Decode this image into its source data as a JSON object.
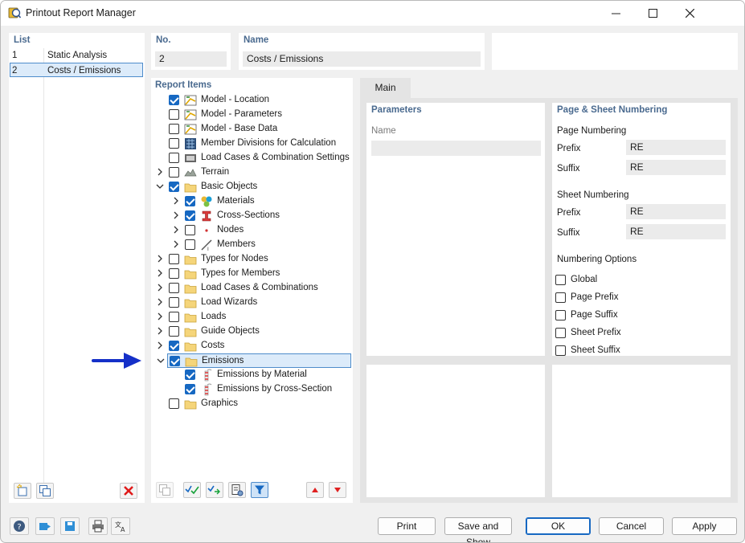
{
  "window": {
    "title": "Printout Report Manager"
  },
  "list": {
    "label": "List",
    "rows": [
      {
        "no": "1",
        "name": "Static Analysis"
      },
      {
        "no": "2",
        "name": "Costs / Emissions"
      }
    ]
  },
  "header": {
    "no_label": "No.",
    "no_value": "2",
    "name_label": "Name",
    "name_value": "Costs / Emissions"
  },
  "report_items": {
    "label": "Report Items",
    "items": [
      {
        "label": "Model - Location",
        "checked": true,
        "icon": "model-location-icon"
      },
      {
        "label": "Model - Parameters",
        "checked": false,
        "icon": "model-parameters-icon"
      },
      {
        "label": "Model - Base Data",
        "checked": false,
        "icon": "model-base-data-icon"
      },
      {
        "label": "Member Divisions for Calculation",
        "checked": false,
        "icon": "member-divisions-icon"
      },
      {
        "label": "Load Cases & Combination Settings",
        "checked": false,
        "icon": "load-settings-icon"
      },
      {
        "label": "Terrain",
        "checked": false,
        "icon": "terrain-icon"
      },
      {
        "label": "Basic Objects",
        "checked": true,
        "icon": "folder-icon"
      },
      {
        "label": "Materials",
        "checked": true,
        "icon": "materials-icon"
      },
      {
        "label": "Cross-Sections",
        "checked": true,
        "icon": "cross-sections-icon"
      },
      {
        "label": "Nodes",
        "checked": false,
        "icon": "nodes-icon"
      },
      {
        "label": "Members",
        "checked": false,
        "icon": "members-icon"
      },
      {
        "label": "Types for Nodes",
        "checked": false,
        "icon": "folder-icon"
      },
      {
        "label": "Types for Members",
        "checked": false,
        "icon": "folder-icon"
      },
      {
        "label": "Load Cases & Combinations",
        "checked": false,
        "icon": "folder-icon"
      },
      {
        "label": "Load Wizards",
        "checked": false,
        "icon": "folder-icon"
      },
      {
        "label": "Loads",
        "checked": false,
        "icon": "folder-icon"
      },
      {
        "label": "Guide Objects",
        "checked": false,
        "icon": "folder-icon"
      },
      {
        "label": "Costs",
        "checked": true,
        "icon": "folder-icon"
      },
      {
        "label": "Emissions",
        "checked": true,
        "icon": "folder-icon"
      },
      {
        "label": "Emissions by Material",
        "checked": true,
        "icon": "emissions-icon"
      },
      {
        "label": "Emissions by Cross-Section",
        "checked": true,
        "icon": "emissions-icon"
      },
      {
        "label": "Graphics",
        "checked": false,
        "icon": "folder-icon"
      }
    ]
  },
  "tabs": [
    {
      "label": "Main"
    }
  ],
  "parameters": {
    "label": "Parameters",
    "name_label": "Name",
    "name_value": ""
  },
  "numbering": {
    "label": "Page & Sheet Numbering",
    "page_heading": "Page Numbering",
    "page_prefix_label": "Prefix",
    "page_prefix": "RE",
    "page_suffix_label": "Suffix",
    "page_suffix": "RE",
    "sheet_heading": "Sheet Numbering",
    "sheet_prefix_label": "Prefix",
    "sheet_prefix": "RE",
    "sheet_suffix_label": "Suffix",
    "sheet_suffix": "RE",
    "options_heading": "Numbering Options",
    "options": [
      {
        "label": "Global",
        "checked": false
      },
      {
        "label": "Page Prefix",
        "checked": false
      },
      {
        "label": "Page Suffix",
        "checked": false
      },
      {
        "label": "Sheet Prefix",
        "checked": false
      },
      {
        "label": "Sheet Suffix",
        "checked": false
      }
    ]
  },
  "buttons": {
    "print": "Print",
    "save_show": "Save and Show",
    "ok": "OK",
    "cancel": "Cancel",
    "apply": "Apply"
  },
  "colors": {
    "accent": "#1668c2",
    "arrow": "#1530c8",
    "label": "#4a6a8f"
  }
}
